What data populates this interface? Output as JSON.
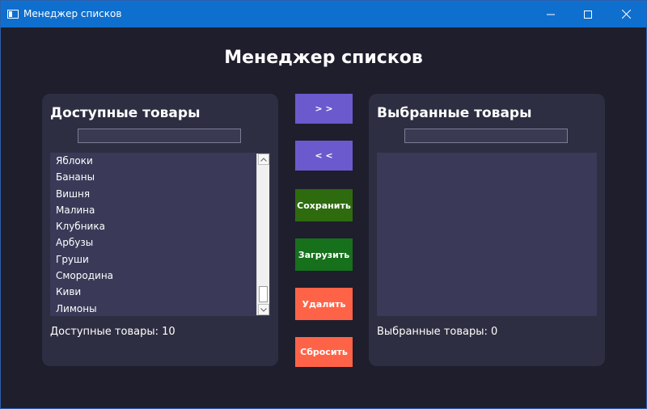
{
  "window": {
    "title": "Менеджер списков"
  },
  "heading": "Менеджер списков",
  "available": {
    "title": "Доступные товары",
    "filter_value": "",
    "items": [
      "Яблоки",
      "Бананы",
      "Вишня",
      "Малина",
      "Клубника",
      "Арбузы",
      "Груши",
      "Смородина",
      "Киви",
      "Лимоны"
    ],
    "counter": "Доступные товары: 10"
  },
  "selected": {
    "title": "Выбранные товары",
    "filter_value": "",
    "items": [],
    "counter": "Выбранные товары: 0"
  },
  "buttons": {
    "move_right": "> >",
    "move_left": "< <",
    "save": "Сохранить",
    "load": "Загрузить",
    "delete": "Удалить",
    "reset": "Сбросить"
  },
  "colors": {
    "titlebar": "#0f6fce",
    "background": "#1e1e2d",
    "panel": "#2e2e42",
    "listbox": "#3a3a58",
    "move_button": "#6a5acd",
    "save_button": "#2e6b0f",
    "load_button": "#17701c",
    "danger_button": "#ff6347"
  },
  "icons": {
    "app": "app-window-icon",
    "minimize": "minimize-icon",
    "maximize": "maximize-icon",
    "close": "close-icon",
    "scroll_up": "chevron-up-icon",
    "scroll_down": "chevron-down-icon"
  }
}
